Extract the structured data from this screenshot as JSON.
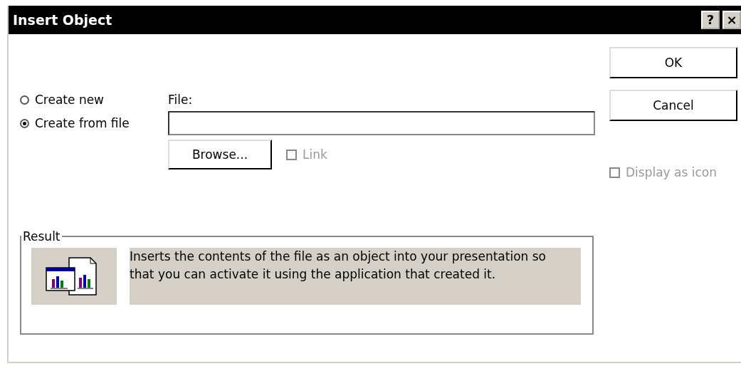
{
  "window": {
    "title": "Insert Object",
    "controls": [
      "?",
      "×"
    ]
  },
  "source_options": [
    {
      "label": "Create new",
      "selected": false
    },
    {
      "label": "Create from file",
      "selected": true
    }
  ],
  "file": {
    "label": "File:"
  },
  "browse_button": "Browse...",
  "link": {
    "label": "Link",
    "checked": false,
    "disabled": true
  },
  "buttons": [
    "OK",
    "Cancel"
  ],
  "display_as_icon": {
    "label": "Display as icon",
    "checked": false,
    "disabled": true
  },
  "result": {
    "title": "Result",
    "text": "Inserts the contents of the file as an object into your presentation so that you can activate it using the application that created it."
  }
}
